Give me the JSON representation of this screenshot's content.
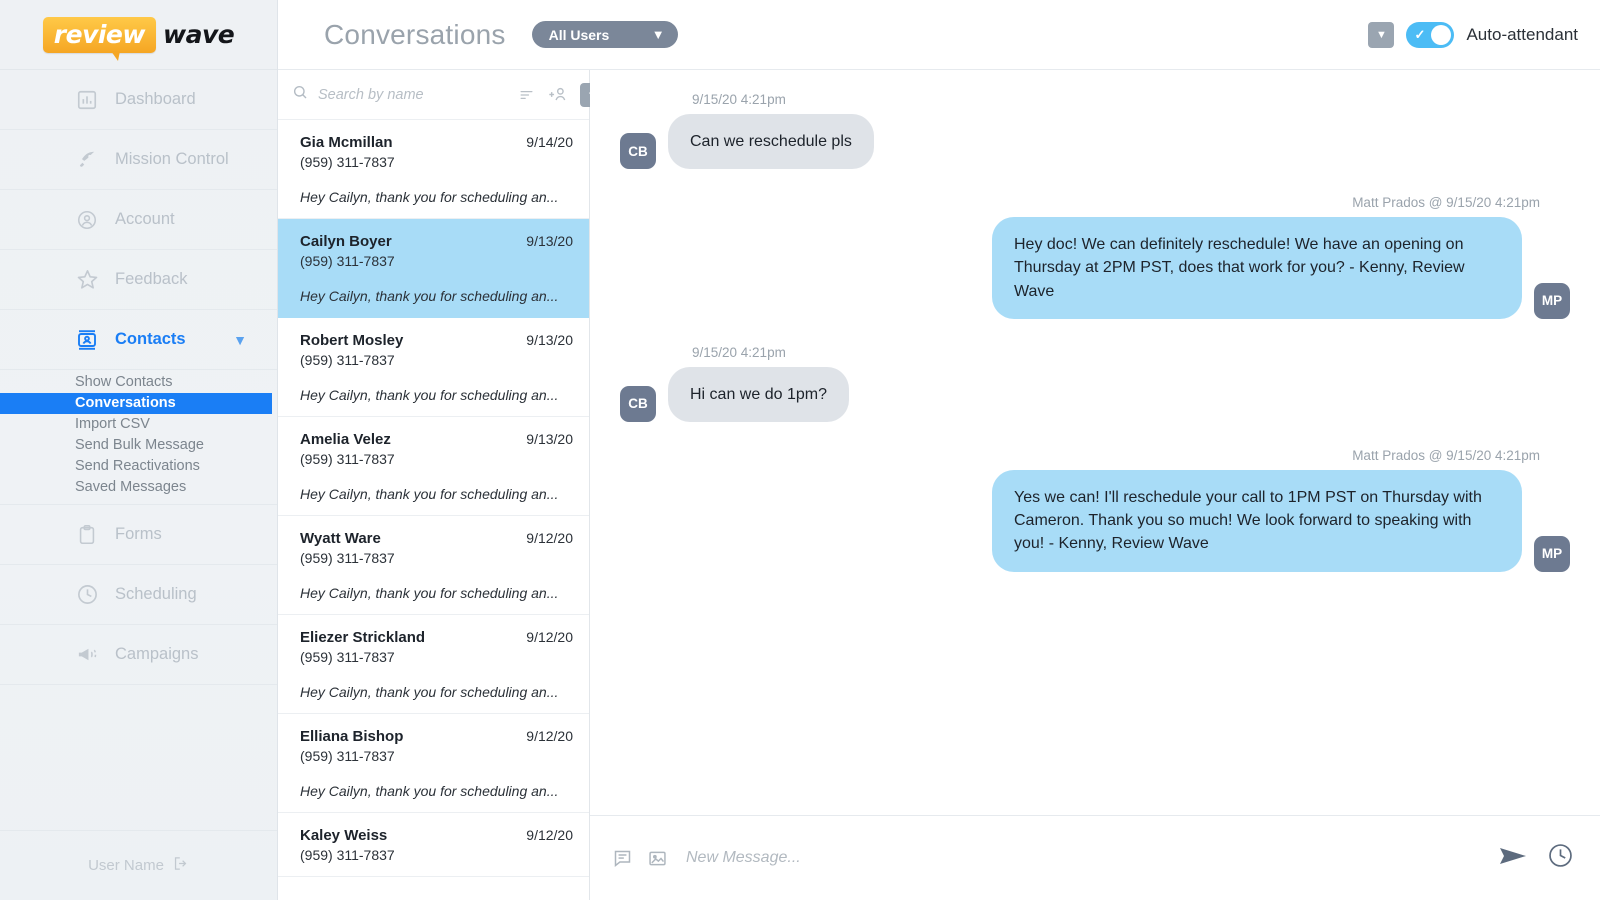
{
  "brand": {
    "logo_primary": "review",
    "logo_secondary": "wave",
    "accent": "#1a7ef5",
    "logo_orange": "#f5a623"
  },
  "sidebar": {
    "items": [
      {
        "label": "Dashboard",
        "icon": "chart-bar-icon",
        "active": false
      },
      {
        "label": "Mission Control",
        "icon": "rocket-icon",
        "active": false
      },
      {
        "label": "Account",
        "icon": "user-circle-icon",
        "active": false
      },
      {
        "label": "Feedback",
        "icon": "star-icon",
        "active": false
      },
      {
        "label": "Contacts",
        "icon": "contact-card-icon",
        "active": true
      },
      {
        "label": "Forms",
        "icon": "clipboard-icon",
        "active": false
      },
      {
        "label": "Scheduling",
        "icon": "clock-icon",
        "active": false
      },
      {
        "label": "Campaigns",
        "icon": "megaphone-icon",
        "active": false
      }
    ],
    "contacts_submenu": [
      {
        "label": "Show Contacts",
        "selected": false
      },
      {
        "label": "Conversations",
        "selected": true
      },
      {
        "label": "Import CSV",
        "selected": false
      },
      {
        "label": "Send Bulk Message",
        "selected": false
      },
      {
        "label": "Send Reactivations",
        "selected": false
      },
      {
        "label": "Saved Messages",
        "selected": false
      }
    ],
    "footer": {
      "user_name": "User Name",
      "logout_icon": "logout-icon"
    }
  },
  "header": {
    "title": "Conversations",
    "user_filter": {
      "value": "All Users",
      "caret_icon": "chevron-down-icon"
    },
    "download_icon": "download-box-icon",
    "auto_attendant": {
      "label": "Auto-attendant",
      "enabled": true,
      "check_icon": "check-icon"
    }
  },
  "convo_list": {
    "search": {
      "placeholder": "Search by name",
      "value": "",
      "icon": "search-icon"
    },
    "actions": [
      {
        "name": "sort-icon"
      },
      {
        "name": "add-contact-icon"
      },
      {
        "name": "download-box-icon"
      }
    ],
    "items": [
      {
        "name": "Gia Mcmillan",
        "phone": "(959) 311-7837",
        "date": "9/14/20",
        "preview": "Hey Cailyn, thank you for scheduling an...",
        "active": false
      },
      {
        "name": "Cailyn Boyer",
        "phone": "(959) 311-7837",
        "date": "9/13/20",
        "preview": "Hey Cailyn, thank you for scheduling an...",
        "active": true
      },
      {
        "name": "Robert Mosley",
        "phone": "(959) 311-7837",
        "date": "9/13/20",
        "preview": "Hey Cailyn, thank you for scheduling an...",
        "active": false
      },
      {
        "name": "Amelia Velez",
        "phone": "(959) 311-7837",
        "date": "9/13/20",
        "preview": "Hey Cailyn, thank you for scheduling an...",
        "active": false
      },
      {
        "name": "Wyatt Ware",
        "phone": "(959) 311-7837",
        "date": "9/12/20",
        "preview": "Hey Cailyn, thank you for scheduling an...",
        "active": false
      },
      {
        "name": "Eliezer Strickland",
        "phone": "(959) 311-7837",
        "date": "9/12/20",
        "preview": "Hey Cailyn, thank you for scheduling an...",
        "active": false
      },
      {
        "name": "Elliana Bishop",
        "phone": "(959) 311-7837",
        "date": "9/12/20",
        "preview": "Hey Cailyn, thank you for scheduling an...",
        "active": false
      },
      {
        "name": "Kaley Weiss",
        "phone": "(959) 311-7837",
        "date": "9/12/20",
        "preview": "",
        "active": false
      }
    ]
  },
  "thread": {
    "messages": [
      {
        "direction": "in",
        "meta": "9/15/20 4:21pm",
        "avatar": "CB",
        "text": "Can we reschedule pls"
      },
      {
        "direction": "out",
        "meta": "Matt Prados @ 9/15/20 4:21pm",
        "avatar": "MP",
        "text": "Hey doc! We can definitely reschedule! We have an opening on Thursday at 2PM PST, does that work for you? - Kenny, Review Wave"
      },
      {
        "direction": "in",
        "meta": "9/15/20 4:21pm",
        "avatar": "CB",
        "text": "Hi can we do 1pm?"
      },
      {
        "direction": "out",
        "meta": "Matt Prados @ 9/15/20 4:21pm",
        "avatar": "MP",
        "text": "Yes we can! I'll reschedule your call to 1PM PST on Thursday with Cameron. Thank you so much! We look forward to speaking with you! - Kenny, Review Wave"
      }
    ]
  },
  "composer": {
    "saved_message_icon": "chat-template-icon",
    "image_icon": "image-icon",
    "placeholder": "New Message...",
    "value": "",
    "send_icon": "send-icon",
    "schedule_icon": "clock-icon"
  }
}
